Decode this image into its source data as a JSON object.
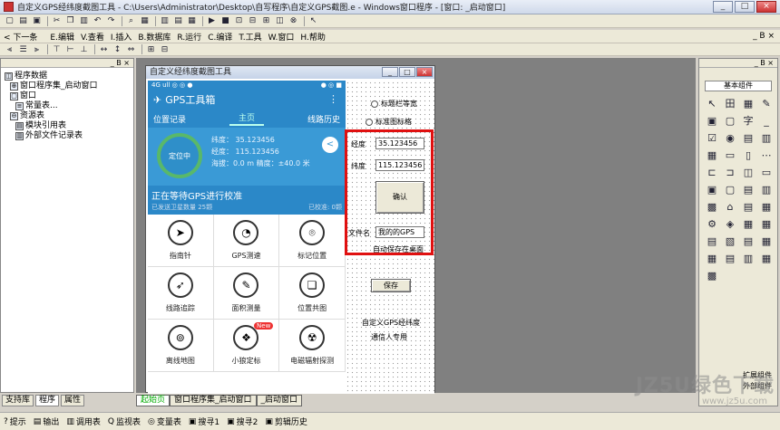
{
  "window": {
    "title": "自定义GPS经纬度截图工具 - C:\\Users\\Administrator\\Desktop\\自写程序\\自定义GPS截图.e - Windows窗口程序 - [窗口: _启动窗口]",
    "controls": [
      "_",
      "□",
      "×"
    ]
  },
  "menubar": {
    "undo": "< 下一条",
    "items": [
      "E.编辑",
      "V.查看",
      "I.插入",
      "B.数据库",
      "R.运行",
      "C.编译",
      "T.工具",
      "W.窗口",
      "H.帮助"
    ],
    "right_controls": "_ B ×"
  },
  "left_panel": {
    "header": "_ B ×",
    "tree": [
      {
        "label": "程序数据",
        "indent": 0
      },
      {
        "label": "窗口程序集_启动窗口",
        "indent": 1
      },
      {
        "label": "窗口",
        "indent": 1
      },
      {
        "label": "常量表...",
        "indent": 2
      },
      {
        "label": "资源表",
        "indent": 1
      },
      {
        "label": "模块引用表",
        "indent": 2
      },
      {
        "label": "外部文件记录表",
        "indent": 2
      }
    ],
    "tabs": [
      "支持库",
      "程序",
      "属性"
    ]
  },
  "design_form": {
    "title": "自定义经纬度截图工具",
    "phone": {
      "status_left": "4G ull ◎ ◎ ●",
      "status_right": "● ◎ ■",
      "app_title": "GPS工具箱",
      "menu_dots": "⋮",
      "tabs": [
        "位置记录",
        "主页",
        "线路历史"
      ],
      "active_tab": 1,
      "compass_label": "定位中",
      "lat": "纬度：  35.123456",
      "lng": "经度：  115.123456",
      "alt": "海拔：0.0 m    精度：±40.0 米",
      "share_icon": "<",
      "waiting": "正在等待GPS进行校准",
      "satellites_left": "已发送卫星数量 25颗",
      "satellites_right": "已校准: 0颗",
      "grid": [
        {
          "label": "指南针",
          "icon": "compass-icon",
          "glyph": "➤"
        },
        {
          "label": "GPS测速",
          "icon": "speedometer-icon",
          "glyph": "◔"
        },
        {
          "label": "标记位置",
          "icon": "location-marker-icon",
          "glyph": "⌾"
        },
        {
          "label": "线路追踪",
          "icon": "navigation-arrow-icon",
          "glyph": "➶"
        },
        {
          "label": "面积测量",
          "icon": "area-measure-icon",
          "glyph": "✎"
        },
        {
          "label": "位置共图",
          "icon": "map-book-icon",
          "glyph": "❏"
        },
        {
          "label": "离线地图",
          "icon": "offline-map-icon",
          "glyph": "⊚"
        },
        {
          "label": "小狼定标",
          "icon": "wolf-icon",
          "glyph": "❖",
          "badge": "New"
        },
        {
          "label": "电磁辐射探测",
          "icon": "radiation-icon",
          "glyph": "☢"
        }
      ]
    },
    "radio_top": "标题栏等宽",
    "radio_second": "标准图标格",
    "lat_label": "经度",
    "lat_value": "35.123456",
    "lng_label": "纬度",
    "lng_value": "115.123456",
    "confirm_button": "确认",
    "filename_label": "文件名",
    "filename_value": "我的的GPS",
    "auto_save": "自动保存在桌面",
    "save_button": "保存",
    "footer_line1": "自定义GPS经纬度",
    "footer_line2": "通信人专用"
  },
  "right_panel": {
    "header": "_ B ×",
    "title": "基本组件",
    "icons": [
      "↖",
      "田",
      "▦",
      "✎",
      "▣",
      "▢",
      "字",
      "_",
      "☑",
      "◉",
      "▤",
      "▥",
      "▦",
      "▭",
      "▯",
      "⋯",
      "⊏",
      "⊐",
      "◫",
      "▭",
      "▣",
      "▢",
      "▤",
      "▥",
      "▩",
      "⌂",
      "▤",
      "▦",
      "⚙",
      "◈",
      "▦",
      "▦",
      "▤",
      "▧",
      "▤",
      "▦",
      "▦",
      "▤",
      "▥",
      "▦",
      "▩"
    ],
    "footer1": "扩展组件",
    "footer2": "外部组件"
  },
  "doc_tabs": [
    "起始页",
    "窗口程序集_启动窗口",
    "_启动窗口"
  ],
  "statusbar": [
    {
      "icon": "?",
      "label": "提示"
    },
    {
      "icon": "▤",
      "label": "输出"
    },
    {
      "icon": "▥",
      "label": "调用表"
    },
    {
      "icon": "Q",
      "label": "监视表"
    },
    {
      "icon": "◎",
      "label": "变量表"
    },
    {
      "icon": "▣",
      "label": "搜寻1"
    },
    {
      "icon": "▣",
      "label": "搜寻2"
    },
    {
      "icon": "▣",
      "label": "剪辑历史"
    }
  ],
  "watermark": "JZ5U绿色下载",
  "watermark_url": "www.jz5u.com"
}
